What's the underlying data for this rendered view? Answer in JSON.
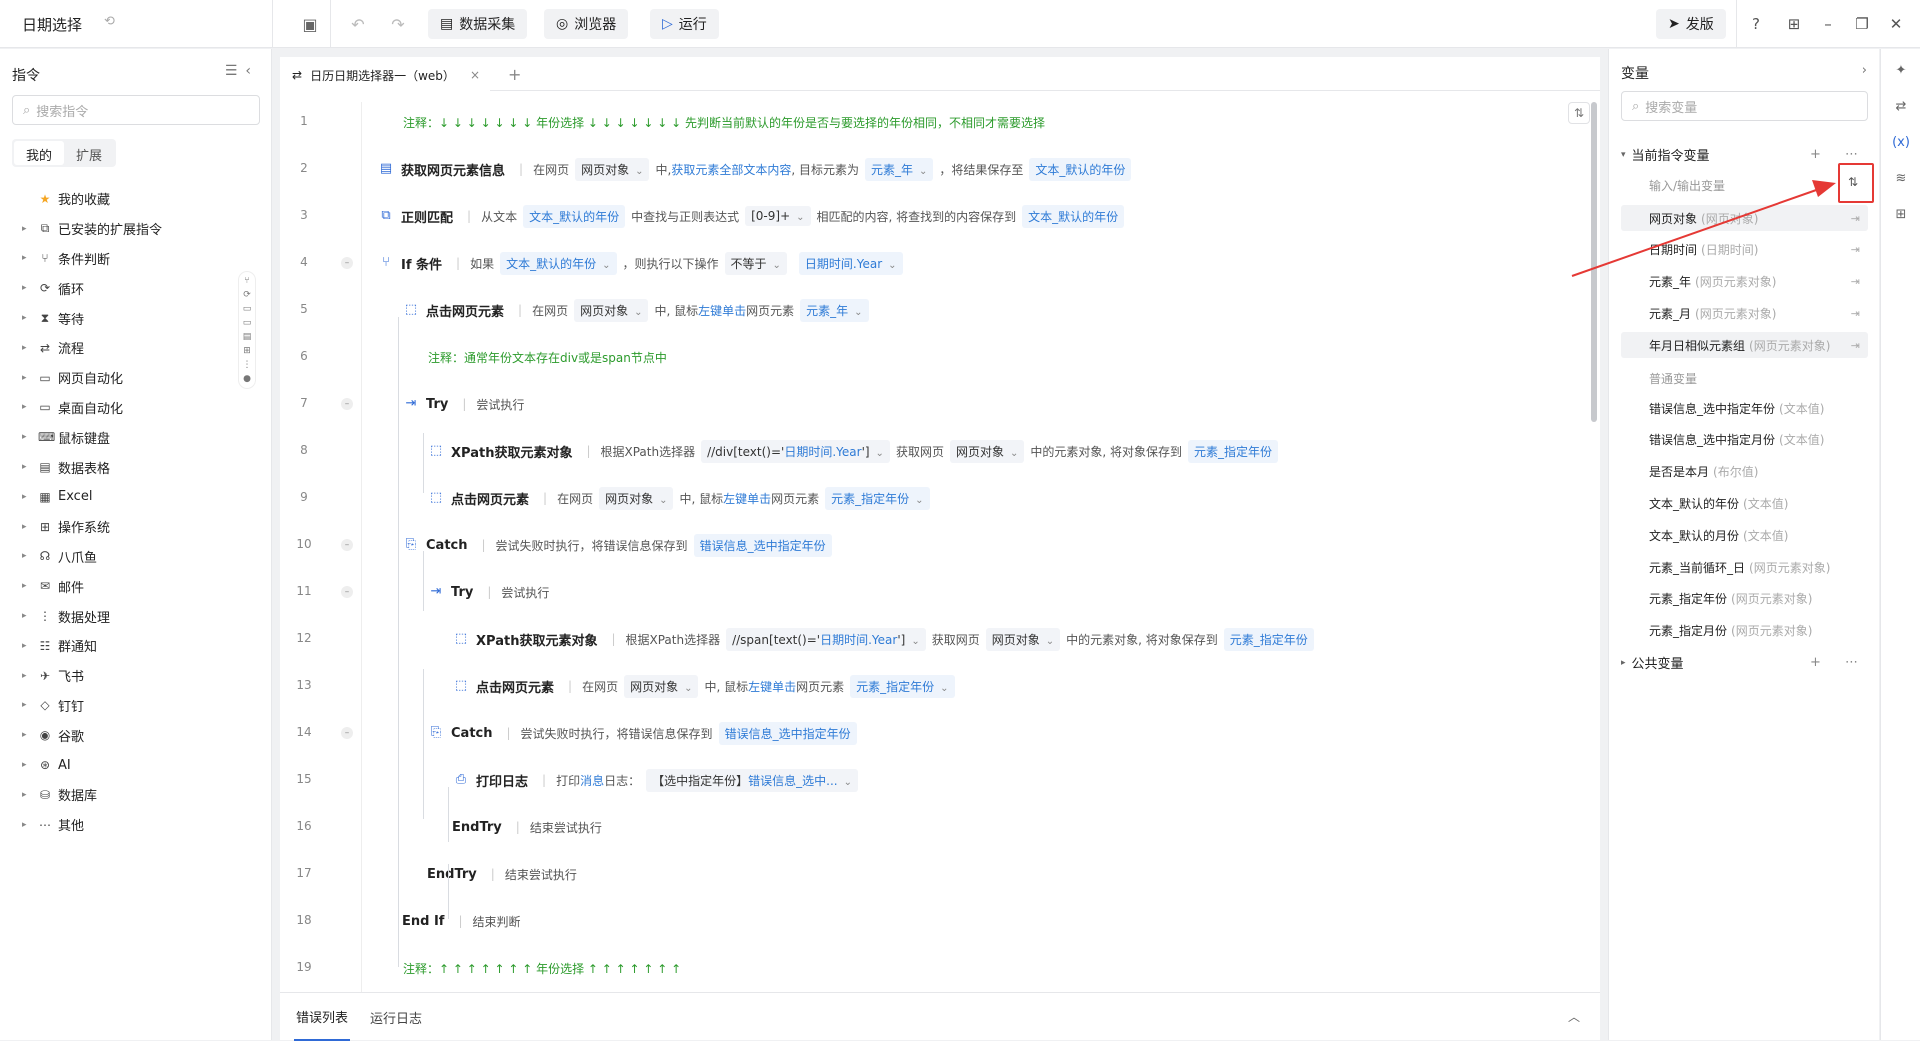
{
  "app": {
    "title": "日期选择"
  },
  "toolbar": {
    "data_collect": "数据采集",
    "browser": "浏览器",
    "run": "运行",
    "publish": "发版"
  },
  "left": {
    "title": "指令",
    "search_placeholder": "搜索指令",
    "tabs": [
      "我的",
      "扩展"
    ],
    "items": [
      {
        "label": "我的收藏",
        "icon": "star-icon"
      },
      {
        "label": "已安装的扩展指令",
        "icon": "extension-icon"
      },
      {
        "label": "条件判断",
        "icon": "branch-icon"
      },
      {
        "label": "循环",
        "icon": "loop-icon"
      },
      {
        "label": "等待",
        "icon": "hourglass-icon"
      },
      {
        "label": "流程",
        "icon": "flow-icon"
      },
      {
        "label": "网页自动化",
        "icon": "web-icon"
      },
      {
        "label": "桌面自动化",
        "icon": "desktop-icon"
      },
      {
        "label": "鼠标键盘",
        "icon": "keyboard-icon"
      },
      {
        "label": "数据表格",
        "icon": "table-icon"
      },
      {
        "label": "Excel",
        "icon": "excel-icon"
      },
      {
        "label": "操作系统",
        "icon": "os-icon"
      },
      {
        "label": "八爪鱼",
        "icon": "octopus-icon"
      },
      {
        "label": "邮件",
        "icon": "mail-icon"
      },
      {
        "label": "数据处理",
        "icon": "data-process-icon"
      },
      {
        "label": "群通知",
        "icon": "group-notify-icon"
      },
      {
        "label": "飞书",
        "icon": "feishu-icon"
      },
      {
        "label": "钉钉",
        "icon": "dingtalk-icon"
      },
      {
        "label": "谷歌",
        "icon": "google-icon"
      },
      {
        "label": "AI",
        "icon": "ai-icon"
      },
      {
        "label": "数据库",
        "icon": "database-icon"
      },
      {
        "label": "其他",
        "icon": "more-icon"
      }
    ]
  },
  "editor": {
    "tab_label": "日历日期选择器一（web）",
    "lines": [
      {
        "n": "1",
        "comment": "注释：↓ ↓ ↓ ↓ ↓ ↓ ↓  年份选择  ↓ ↓ ↓ ↓ ↓ ↓ ↓  先判断当前默认的年份是否与要选择的年份相同，不相同才需要选择"
      },
      {
        "n": "2",
        "cmd": "获取网页元素信息",
        "t1": "在网页",
        "c1": "网页对象",
        "t2": "中,",
        "b1": "获取元素全部文本内容",
        "t3": ", 目标元素为",
        "c2": "元素_年",
        "t4": "，将结果保存至",
        "c3": "文本_默认的年份"
      },
      {
        "n": "3",
        "cmd": "正则匹配",
        "t1": "从文本",
        "c1": "文本_默认的年份",
        "t2": "中查找与正则表达式",
        "c2": "[0-9]+",
        "t3": "相匹配的内容, 将查找到的内容保存到",
        "c3": "文本_默认的年份"
      },
      {
        "n": "4",
        "cmd": "If 条件",
        "t1": "如果",
        "c1": "文本_默认的年份",
        "c2": "不等于",
        "c3": "日期时间.Year",
        "t2": "，则执行以下操作"
      },
      {
        "n": "5",
        "cmd": "点击网页元素",
        "t1": "在网页",
        "c1": "网页对象",
        "t2": "中, 鼠标",
        "b1": "左键单击",
        "t3": "网页元素",
        "c2": "元素_年"
      },
      {
        "n": "6",
        "comment": "注释：通常年份文本存在div或是span节点中"
      },
      {
        "n": "7",
        "cmd": "Try",
        "t1": "尝试执行"
      },
      {
        "n": "8",
        "cmd": "XPath获取元素对象",
        "t1": "根据XPath选择器",
        "c1": "//div[text()='",
        "b1": "日期时间.Year",
        "c1b": "']",
        "t2": "获取网页",
        "c2": "网页对象",
        "t3": "中的元素对象, 将对象保存到",
        "c3": "元素_指定年份"
      },
      {
        "n": "9",
        "cmd": "点击网页元素",
        "t1": "在网页",
        "c1": "网页对象",
        "t2": "中, 鼠标",
        "b1": "左键单击",
        "t3": "网页元素",
        "c2": "元素_指定年份"
      },
      {
        "n": "10",
        "cmd": "Catch",
        "t1": "尝试失败时执行，将错误信息保存到",
        "c1": "错误信息_选中指定年份"
      },
      {
        "n": "11",
        "cmd": "Try",
        "t1": "尝试执行"
      },
      {
        "n": "12",
        "cmd": "XPath获取元素对象",
        "t1": "根据XPath选择器",
        "c1": "//span[text()='",
        "b1": "日期时间.Year",
        "c1b": "']",
        "t2": "获取网页",
        "c2": "网页对象",
        "t3": "中的元素对象, 将对象保存到",
        "c3": "元素_指定年份"
      },
      {
        "n": "13",
        "cmd": "点击网页元素",
        "t1": "在网页",
        "c1": "网页对象",
        "t2": "中, 鼠标",
        "b1": "左键单击",
        "t3": "网页元素",
        "c2": "元素_指定年份"
      },
      {
        "n": "14",
        "cmd": "Catch",
        "t1": "尝试失败时执行，将错误信息保存到",
        "c1": "错误信息_选中指定年份"
      },
      {
        "n": "15",
        "cmd": "打印日志",
        "t1": "打印",
        "b1": "消息",
        "t2": "日志：",
        "c1": "【选中指定年份】",
        "b2": "错误信息_选中..."
      },
      {
        "n": "16",
        "cmd": "EndTry",
        "t1": "结束尝试执行"
      },
      {
        "n": "17",
        "cmd": "EndTry",
        "t1": "结束尝试执行"
      },
      {
        "n": "18",
        "cmd": "End If",
        "t1": "结束判断"
      },
      {
        "n": "19",
        "comment": "注释：↑ ↑ ↑ ↑ ↑ ↑ ↑  年份选择  ↑ ↑ ↑ ↑ ↑ ↑ ↑"
      }
    ]
  },
  "bottom": {
    "tabs": [
      "错误列表",
      "运行日志"
    ]
  },
  "right": {
    "title": "变量",
    "search_placeholder": "搜索变量",
    "current_section": "当前指令变量",
    "io_label": "输入/输出变量",
    "io_vars": [
      {
        "name": "网页对象",
        "type": "(网页对象)"
      },
      {
        "name": "日期时间",
        "type": "(日期时间)"
      },
      {
        "name": "元素_年",
        "type": "(网页元素对象)"
      },
      {
        "name": "元素_月",
        "type": "(网页元素对象)"
      },
      {
        "name": "年月日相似元素组",
        "type": "(网页元素对象)"
      }
    ],
    "normal_label": "普通变量",
    "normal_vars": [
      {
        "name": "错误信息_选中指定年份",
        "type": "(文本值)"
      },
      {
        "name": "错误信息_选中指定月份",
        "type": "(文本值)"
      },
      {
        "name": "是否是本月",
        "type": "(布尔值)"
      },
      {
        "name": "文本_默认的年份",
        "type": "(文本值)"
      },
      {
        "name": "文本_默认的月份",
        "type": "(文本值)"
      },
      {
        "name": "元素_当前循环_日",
        "type": "(网页元素对象)"
      },
      {
        "name": "元素_指定年份",
        "type": "(网页元素对象)"
      },
      {
        "name": "元素_指定月份",
        "type": "(网页元素对象)"
      }
    ],
    "public_section": "公共变量"
  },
  "colors": {
    "accent": "#2f6ad6",
    "comment": "#2c9b2c",
    "highlight_box": "#e53935"
  }
}
